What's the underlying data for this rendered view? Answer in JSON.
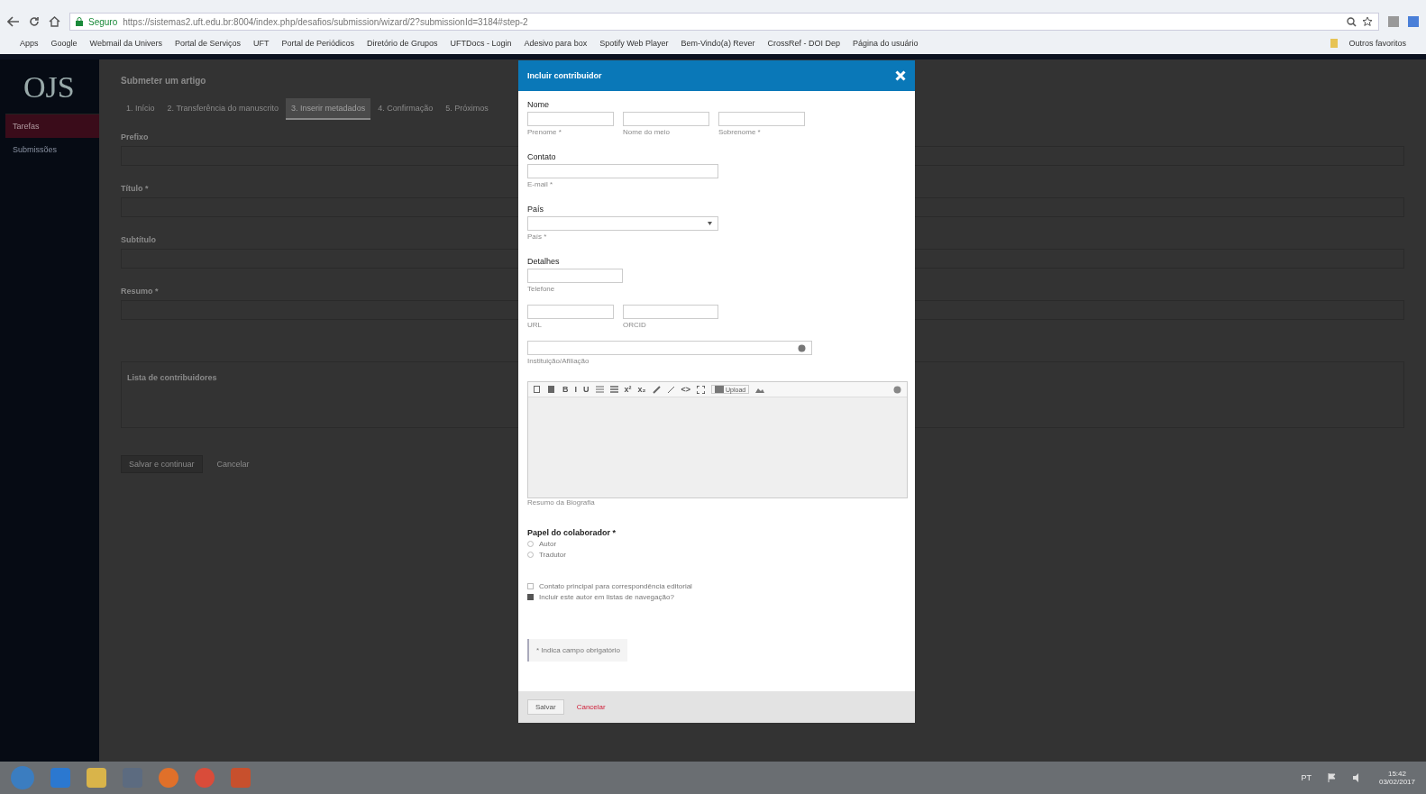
{
  "browser": {
    "secure_label": "Seguro",
    "url": "https://sistemas2.uft.edu.br:8004/index.php/desafios/submission/wizard/2?submissionId=3184#step-2",
    "bookmarks": [
      "Apps",
      "Google",
      "Webmail da Univers",
      "Portal de Serviços",
      "UFT",
      "Portal de Periódicos",
      "Diretório de Grupos",
      "UFTDocs - Login",
      "Adesivo para box",
      "Spotify Web Player",
      "Bem-Vindo(a) Rever",
      "CrossRef - DOI Dep",
      "Página do usuário"
    ],
    "other_bookmarks": "Outros favoritos"
  },
  "ojs": {
    "logo": "OJS",
    "sidebar": [
      {
        "label": "Tarefas",
        "selected": true
      },
      {
        "label": "Submissões",
        "selected": false
      }
    ],
    "page_title": "Submeter um artigo",
    "tabs": [
      {
        "label": "1. Início",
        "selected": false
      },
      {
        "label": "2. Transferência do manuscrito",
        "selected": false
      },
      {
        "label": "3. Inserir metadados",
        "selected": true
      },
      {
        "label": "4. Confirmação",
        "selected": false
      },
      {
        "label": "5. Próximos",
        "selected": false
      }
    ],
    "fields": [
      "Prefixo",
      "Título *",
      "Subtítulo",
      "Resumo *"
    ],
    "contributors_heading": "Lista de contribuidores",
    "buttons": [
      "Salvar e continuar",
      "Cancelar"
    ]
  },
  "modal": {
    "title": "Incluir contribuidor",
    "name_label": "Nome",
    "name_fields": [
      "Prenome *",
      "Nome do meio",
      "Sobrenome *"
    ],
    "contact_label": "Contato",
    "email_field": "E-mail *",
    "country_label": "País",
    "country_field": "País *",
    "details_label": "Detalhes",
    "phone_field": "Telefone",
    "url_field": "URL",
    "orcid_field": "ORCID",
    "affiliation_field": "Instituição/Afiliação",
    "toolbar": [
      {
        "kind": "copy"
      },
      {
        "kind": "paste"
      },
      {
        "kind": "text",
        "label": "B"
      },
      {
        "kind": "text",
        "label": "I"
      },
      {
        "kind": "text",
        "label": "U"
      },
      {
        "kind": "bullets"
      },
      {
        "kind": "numbers"
      },
      {
        "kind": "text",
        "label": "x²"
      },
      {
        "kind": "text",
        "label": "x₂"
      },
      {
        "kind": "link"
      },
      {
        "kind": "unlink"
      },
      {
        "kind": "text",
        "label": "<>"
      },
      {
        "kind": "fullscreen"
      },
      {
        "kind": "upload",
        "label": "Upload"
      },
      {
        "kind": "image"
      }
    ],
    "bio_field": "Resumo da Biografia",
    "role_label": "Papel do colaborador *",
    "roles": [
      {
        "label": "Autor",
        "selected": false
      },
      {
        "label": "Tradutor",
        "selected": false
      }
    ],
    "options": [
      {
        "label": "Contato principal para correspondência editorial",
        "checked": false
      },
      {
        "label": "Incluir este autor em listas de navegação?",
        "checked": true
      }
    ],
    "required_note": "* Indica campo obrigatório",
    "save": "Salvar",
    "cancel": "Cancelar"
  },
  "taskbar": {
    "language": "PT",
    "time": "15:42",
    "date": "03/02/2017"
  }
}
